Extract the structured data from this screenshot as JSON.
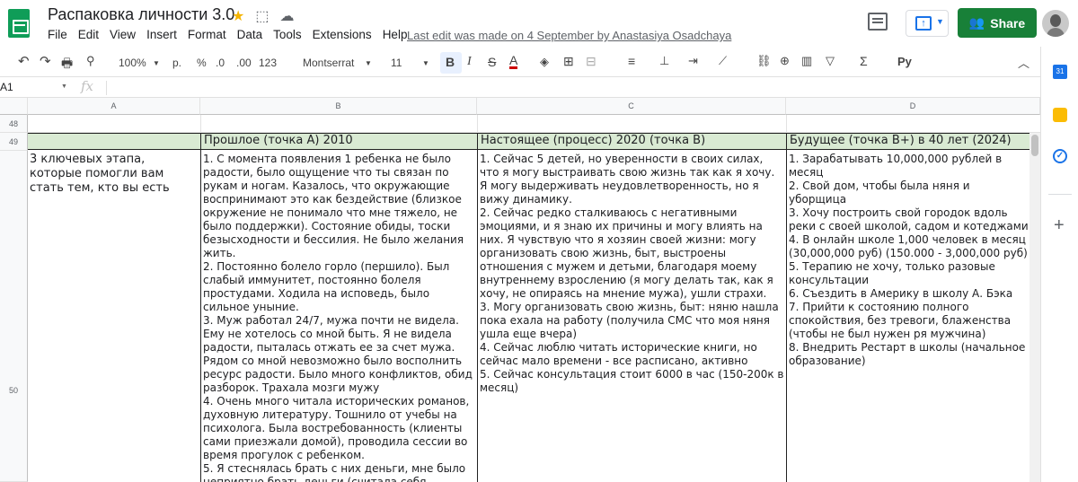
{
  "app": {
    "title": "Распаковка личности 3.0",
    "menu": [
      "File",
      "Edit",
      "View",
      "Insert",
      "Format",
      "Data",
      "Tools",
      "Extensions",
      "Help"
    ],
    "last_edit": "Last edit was made on 4 September by Anastasiya Osadchaya",
    "share_label": "Share"
  },
  "toolbar": {
    "zoom": "100%",
    "currency": "р.",
    "percent": "%",
    "dec_less": ".0",
    "dec_more": ".00",
    "format_more": "123",
    "font": "Montserrat",
    "font_size": "11",
    "bold": "B",
    "italic": "I",
    "strike": "S",
    "text_color": "A",
    "sigma": "Σ",
    "input_tools": "Pу"
  },
  "formula_bar": {
    "cell_ref": "A1",
    "fx": "fx"
  },
  "columns": [
    "A",
    "B",
    "C",
    "D"
  ],
  "rows": {
    "r48": "48",
    "r49": "49",
    "r50": "50"
  },
  "header_row": {
    "b": "Прошлое (точка А) 2010",
    "c": "Настоящее (процесс) 2020 (точка В)",
    "d": "Будущее (точка В+) в 40 лет (2024)"
  },
  "content_row": {
    "a": "3 ключевых этапа, которые помогли вам стать тем, кто вы есть",
    "b": "1. С момента появления 1 ребенка не было радости, было ощущение что ты связан по рукам и ногам. Казалось, что окружающие воспринимают это как бездействие (близкое окружение не понимало что мне тяжело, не было поддержки). Состояние обиды, тоски безысходности и бессилия. Не было желания жить.\n2. Постоянно болело горло (першило). Был слабый иммунитет, постоянно болеля простудами. Ходила на исповедь, было сильное уныние.\n3. Муж работал 24/7, мужа почти не видела. Ему не хотелось со мной быть. Я не видела радости, пыталась отжать ее за счет мужа. Рядом со мной невозможно было восполнить ресурс радости. Было много конфликтов, обид разборок. Трахала мозги мужу\n4. Очень много читала исторических романов, духовную литературу. Тошнило от учебы на психолога. Была востребованность (клиенты сами приезжали домой), проводила сессии во время прогулок с ребенком.\n5. Я стеснялась брать с них деньги, мне было неприятно брать деньги (считала себя недостойной). Не могла организовать себе",
    "c": "1. Сейчас 5 детей, но уверенности в своих силах, что я могу выстраивать свою жизнь так как я хочу. Я могу выдерживать неудовлетворенность, но я вижу динамику.\n2. Сейчас редко сталкиваюсь с негативными эмоциями, и я знаю их причины и могу влиять на них. Я чувствую что я хозяин своей жизни: могу организовать свою жизнь, быт, выстроены отношения с мужем и детьми, благодаря моему внутреннему взрослению (я могу делать так, как я хочу, не опираясь на мнение мужа), ушли страхи.\n3. Могу организовать свою жизнь, быт: няню нашла пока ехала на работу (получила СМС что моя няня ушла еще вчера)\n4. Сейчас люблю читать исторические книги, но сейчас мало времени - все расписано, активно\n5. Сейчас консультация стоит 6000 в час (150-200к в месяц)",
    "d": "1. Зарабатывать 10,000,000 рублей в месяц\n2. Свой дом, чтобы была няня и уборщица\n3. Хочу построить свой городок вдоль реки с своей школой, садом и котеджами\n4. В онлайн школе 1,000 человек в месяц (30,000,000 руб) (150.000 - 3,000,000 руб)\n5. Терапию не хочу, только разовые консультации\n6. Съездить в Америку в школу А. Бэка\n7. Прийти к состоянию полного спокойствия, без тревоги, блаженства (чтобы не был нужен ря мужчина)\n8. Внедрить Рестарт в школы (начальное образование)"
  },
  "colors": {
    "header_fill": "#d9ead3",
    "share_button": "#188038",
    "sheets_logo": "#0f9d58"
  }
}
